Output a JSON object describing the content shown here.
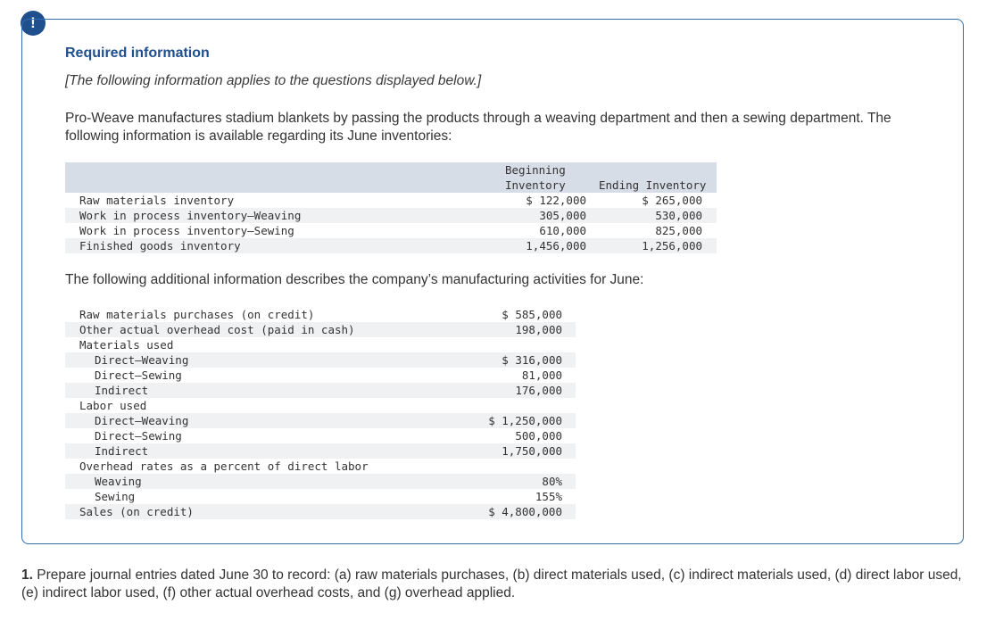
{
  "alert_glyph": "!",
  "required_title": "Required information",
  "required_subtitle": "[The following information applies to the questions displayed below.]",
  "intro_text": "Pro-Weave manufactures stadium blankets by passing the products through a weaving department and then a sewing department. The following information is available regarding its June inventories:",
  "inventory_table": {
    "col_beginning_line1": "Beginning",
    "col_beginning_line2": "Inventory",
    "col_ending": "Ending Inventory",
    "rows": [
      {
        "label": "Raw materials inventory",
        "beginning": "$ 122,000",
        "ending": "$ 265,000"
      },
      {
        "label": "Work in process inventory—Weaving",
        "beginning": "305,000",
        "ending": "530,000"
      },
      {
        "label": "Work in process inventory—Sewing",
        "beginning": "610,000",
        "ending": "825,000"
      },
      {
        "label": "Finished goods inventory",
        "beginning": "1,456,000",
        "ending": "1,256,000"
      }
    ]
  },
  "additional_text": "The following additional information describes the company’s manufacturing activities for June:",
  "activity_table": [
    {
      "label": "Raw materials purchases (on credit)",
      "value": "$ 585,000"
    },
    {
      "label": "Other actual overhead cost (paid in cash)",
      "value": "198,000"
    },
    {
      "label": "Materials used",
      "value": ""
    },
    {
      "label": "Direct—Weaving",
      "value": "$ 316,000"
    },
    {
      "label": "Direct—Sewing",
      "value": "81,000"
    },
    {
      "label": "Indirect",
      "value": "176,000"
    },
    {
      "label": "Labor used",
      "value": ""
    },
    {
      "label": "Direct—Weaving",
      "value": "$ 1,250,000"
    },
    {
      "label": "Direct—Sewing",
      "value": "500,000"
    },
    {
      "label": "Indirect",
      "value": "1,750,000"
    },
    {
      "label": "Overhead rates as a percent of direct labor",
      "value": ""
    },
    {
      "label": "Weaving",
      "value": "80%"
    },
    {
      "label": "Sewing",
      "value": "155%"
    },
    {
      "label": "Sales (on credit)",
      "value": "$ 4,800,000"
    }
  ],
  "question": {
    "number": "1.",
    "text": " Prepare journal entries dated June 30 to record: (a) raw materials purchases, (b) direct materials used, (c) indirect materials used, (d) direct labor used, (e) indirect labor used, (f) other actual overhead costs, and (g) overhead applied."
  }
}
